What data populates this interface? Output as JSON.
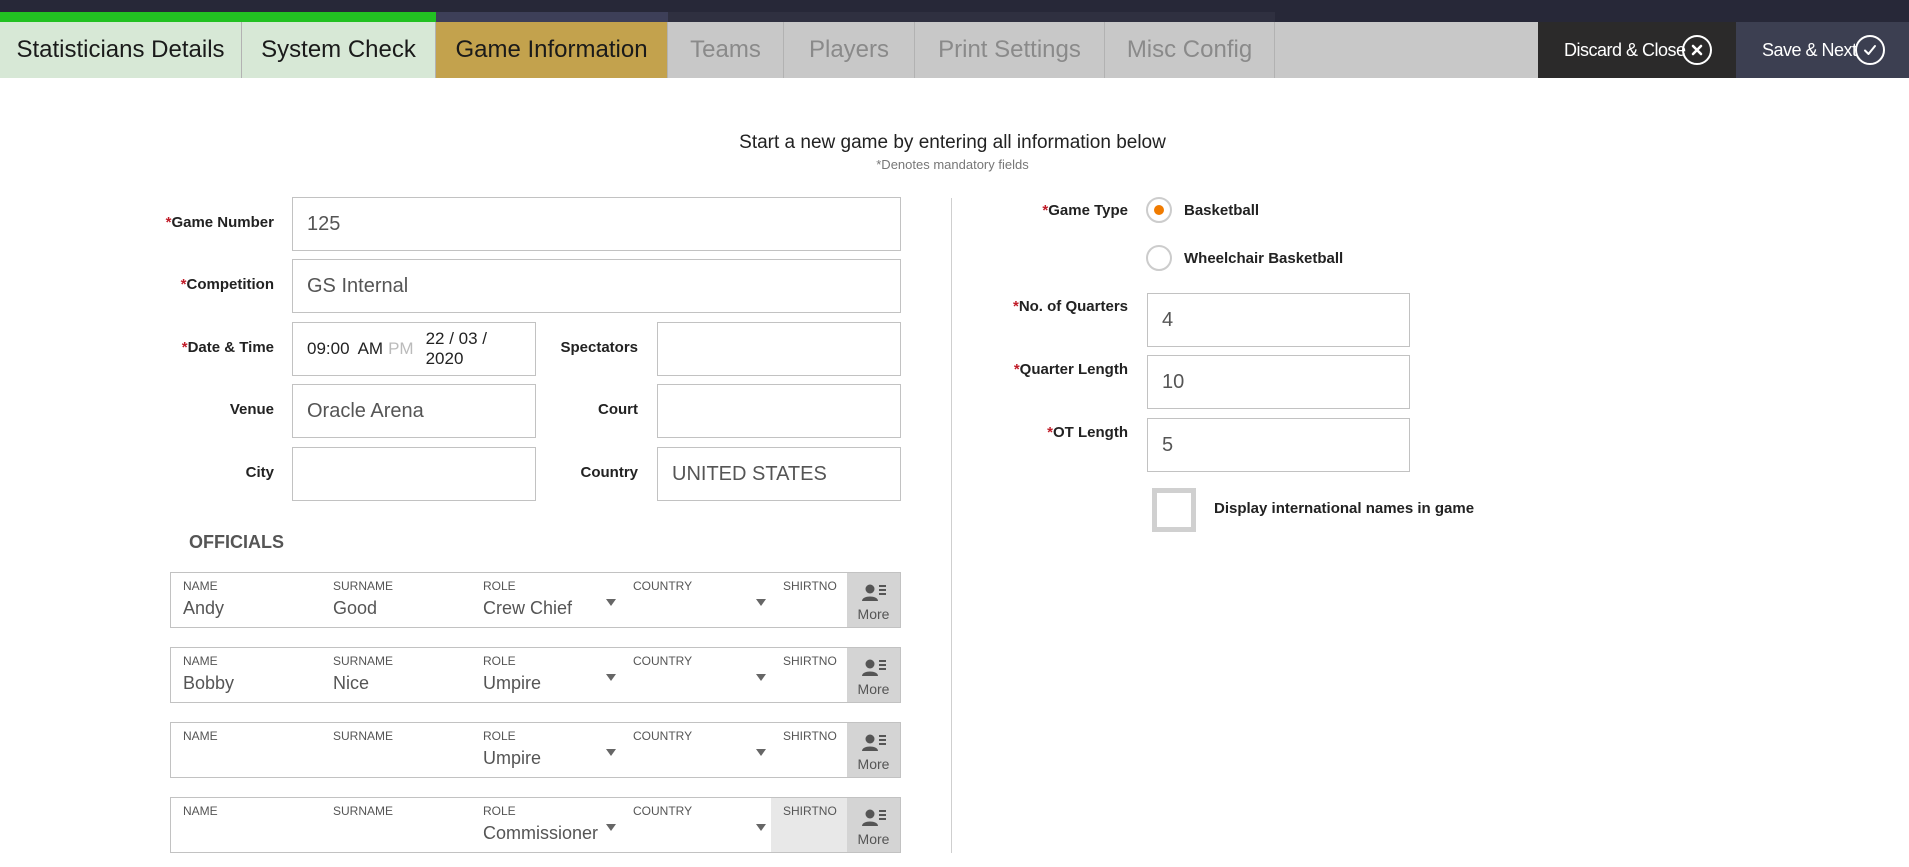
{
  "tabs": [
    {
      "label": "Statisticians Details",
      "state": "done"
    },
    {
      "label": "System Check",
      "state": "done"
    },
    {
      "label": "Game Information",
      "state": "active"
    },
    {
      "label": "Teams",
      "state": "pending"
    },
    {
      "label": "Players",
      "state": "pending"
    },
    {
      "label": "Print Settings",
      "state": "pending"
    },
    {
      "label": "Misc Config",
      "state": "pending"
    }
  ],
  "progress": {
    "completed_steps": 2,
    "total_steps": 7,
    "colors": {
      "done": "#22c122",
      "current": "#3d3f58",
      "remaining": "#2f3040"
    }
  },
  "actions": {
    "discard_label": "Discard & Close",
    "save_label": "Save & Next"
  },
  "intro": {
    "title": "Start a new game by entering all information below",
    "subtitle": "*Denotes mandatory fields"
  },
  "required_marker": "*",
  "form": {
    "game_number": {
      "label": "Game Number",
      "value": "125"
    },
    "competition": {
      "label": "Competition",
      "value": "GS Internal"
    },
    "date_time": {
      "label": "Date & Time",
      "hour": "09",
      "minute": "00",
      "am": "AM",
      "pm": "PM",
      "date": "22 / 03 / 2020"
    },
    "spectators": {
      "label": "Spectators",
      "value": ""
    },
    "venue": {
      "label": "Venue",
      "value": "Oracle Arena"
    },
    "court": {
      "label": "Court",
      "value": ""
    },
    "city": {
      "label": "City",
      "value": ""
    },
    "country": {
      "label": "Country",
      "value": "UNITED STATES"
    }
  },
  "officials": {
    "title": "OFFICIALS",
    "headers": {
      "name": "NAME",
      "surname": "SURNAME",
      "role": "ROLE",
      "country": "COUNTRY",
      "shirtno": "SHIRTNO"
    },
    "more_label": "More",
    "rows": [
      {
        "name": "Andy",
        "surname": "Good",
        "role": "Crew Chief",
        "country": "",
        "shirtno": ""
      },
      {
        "name": "Bobby",
        "surname": "Nice",
        "role": "Umpire",
        "country": "",
        "shirtno": ""
      },
      {
        "name": "",
        "surname": "",
        "role": "Umpire",
        "country": "",
        "shirtno": ""
      },
      {
        "name": "",
        "surname": "",
        "role": "Commissioner",
        "country": "",
        "shirtno": ""
      }
    ]
  },
  "game_settings": {
    "game_type_label": "Game Type",
    "game_types": [
      {
        "label": "Basketball",
        "selected": true
      },
      {
        "label": "Wheelchair Basketball",
        "selected": false
      }
    ],
    "quarters": {
      "label": "No. of Quarters",
      "value": "4"
    },
    "quarter_length": {
      "label": "Quarter Length",
      "value": "10"
    },
    "ot_length": {
      "label": "OT Length",
      "value": "5"
    },
    "intl_names": {
      "label": "Display international names in game",
      "checked": false
    }
  },
  "accent_colors": {
    "active_tab": "#c3a24d",
    "done_tab": "#d7e8d6",
    "radio_selected": "#f07b00",
    "required": "#c01c28"
  }
}
